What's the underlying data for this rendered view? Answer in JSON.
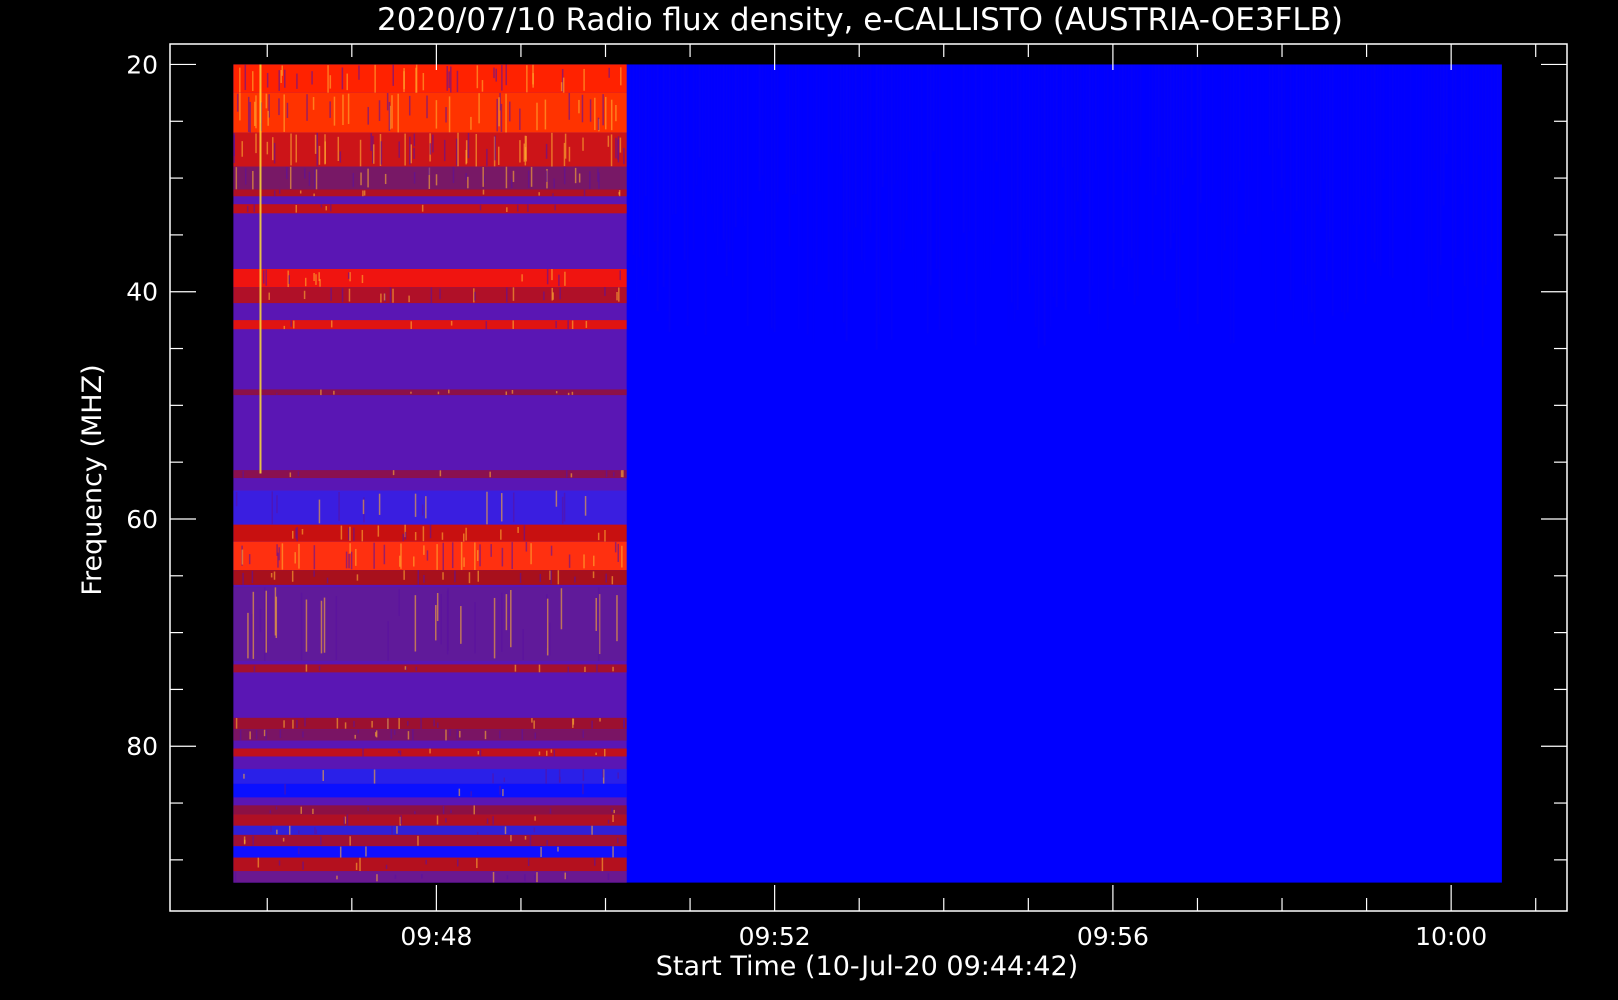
{
  "chart_data": {
    "type": "heatmap",
    "title": "2020/07/10  Radio flux density, e-CALLISTO (AUSTRIA-OE3FLB)",
    "xlabel": "Start Time (10-Jul-20 09:44:42)",
    "ylabel": "Frequency (MHZ)",
    "x_ticks": [
      "09:48",
      "09:52",
      "09:56",
      "10:00"
    ],
    "x_tick_minutes": [
      228,
      232,
      236,
      240
    ],
    "x_minor_step_minutes": 1,
    "y_ticks": [
      "20",
      "40",
      "60",
      "80"
    ],
    "y_tick_values": [
      20,
      40,
      60,
      80
    ],
    "y_minor_step": 5,
    "xlim_minutes": [
      224.85,
      241.37
    ],
    "ylim": [
      94.5,
      18.2
    ],
    "data_time_range_minutes": [
      225.6,
      240.6
    ],
    "data_freq_range": [
      20,
      92
    ],
    "active_segment_end_minutes": 230.25,
    "background_color": "#0000ff",
    "active_base_color": "#5a16b4",
    "bands": [
      {
        "f0": 20.0,
        "f1": 22.5,
        "color": "#ff2200",
        "noise": 0.35
      },
      {
        "f0": 22.5,
        "f1": 26.0,
        "color": "#ff3300",
        "noise": 0.45
      },
      {
        "f0": 26.0,
        "f1": 29.0,
        "color": "#cc1418",
        "noise": 0.5
      },
      {
        "f0": 29.0,
        "f1": 31.0,
        "color": "#781866",
        "noise": 0.3
      },
      {
        "f0": 31.0,
        "f1": 31.6,
        "color": "#b01024",
        "noise": 0.1
      },
      {
        "f0": 32.3,
        "f1": 33.1,
        "color": "#c0101c",
        "noise": 0.1
      },
      {
        "f0": 38.0,
        "f1": 39.6,
        "color": "#f01410",
        "noise": 0.15
      },
      {
        "f0": 39.6,
        "f1": 41.0,
        "color": "#b01028",
        "noise": 0.2
      },
      {
        "f0": 42.5,
        "f1": 43.3,
        "color": "#e01412",
        "noise": 0.1
      },
      {
        "f0": 48.6,
        "f1": 49.1,
        "color": "#8c1048",
        "noise": 0.1
      },
      {
        "f0": 55.7,
        "f1": 56.4,
        "color": "#8a1050",
        "noise": 0.1
      },
      {
        "f0": 57.5,
        "f1": 60.5,
        "color": "#3a1ee0",
        "noise": 0.15
      },
      {
        "f0": 60.5,
        "f1": 62.0,
        "color": "#c81010",
        "noise": 0.2
      },
      {
        "f0": 62.0,
        "f1": 64.5,
        "color": "#ff3010",
        "noise": 0.35
      },
      {
        "f0": 64.5,
        "f1": 65.8,
        "color": "#a8101c",
        "noise": 0.2
      },
      {
        "f0": 66.0,
        "f1": 72.5,
        "color": "#601a9a",
        "noise": 0.3
      },
      {
        "f0": 72.8,
        "f1": 73.5,
        "color": "#a4102e",
        "noise": 0.1
      },
      {
        "f0": 77.5,
        "f1": 78.5,
        "color": "#9c1030",
        "noise": 0.2
      },
      {
        "f0": 78.5,
        "f1": 79.5,
        "color": "#7a1464",
        "noise": 0.2
      },
      {
        "f0": 80.2,
        "f1": 80.9,
        "color": "#c0101c",
        "noise": 0.1
      },
      {
        "f0": 82.0,
        "f1": 83.3,
        "color": "#2a20e8",
        "noise": 0.1
      },
      {
        "f0": 83.3,
        "f1": 84.5,
        "color": "#0a10ff",
        "noise": 0.05
      },
      {
        "f0": 85.2,
        "f1": 86.0,
        "color": "#8c1044",
        "noise": 0.1
      },
      {
        "f0": 86.0,
        "f1": 87.0,
        "color": "#b01024",
        "noise": 0.1
      },
      {
        "f0": 87.0,
        "f1": 87.8,
        "color": "#3020d8",
        "noise": 0.1
      },
      {
        "f0": 87.8,
        "f1": 88.8,
        "color": "#a01034",
        "noise": 0.1
      },
      {
        "f0": 88.8,
        "f1": 89.8,
        "color": "#1010ff",
        "noise": 0.05
      },
      {
        "f0": 89.8,
        "f1": 91.0,
        "color": "#b4101e",
        "noise": 0.1
      },
      {
        "f0": 91.0,
        "f1": 92.0,
        "color": "#6a1890",
        "noise": 0.1
      }
    ],
    "bursts": [
      {
        "t": 225.92,
        "f0": 20,
        "f1": 56,
        "color": "#ffdd33"
      }
    ]
  }
}
